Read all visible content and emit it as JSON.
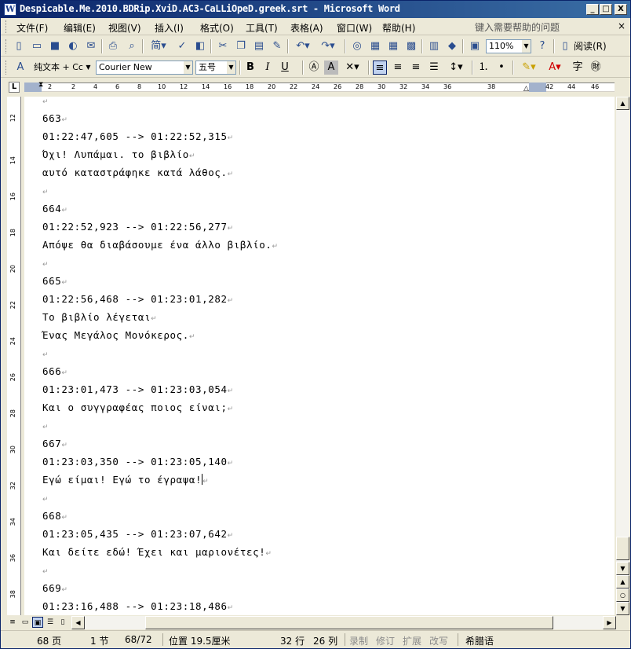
{
  "window": {
    "title": "Despicable.Me.2010.BDRip.XviD.AC3-CaLLiOpeD.greek.srt - Microsoft Word",
    "app_icon": "W",
    "minimize": "_",
    "maximize": "□",
    "close": "X"
  },
  "menu": {
    "items": [
      "文件(F)",
      "编辑(E)",
      "视图(V)",
      "插入(I)",
      "格式(O)",
      "工具(T)",
      "表格(A)",
      "窗口(W)",
      "帮助(H)"
    ],
    "help_placeholder": "键入需要帮助的问题",
    "close_doc": "×"
  },
  "toolbar_standard": {
    "zoom": "110%",
    "read_label": "阅读(R)"
  },
  "toolbar_format": {
    "style": "纯文本 + Cc",
    "font": "Courier New",
    "size": "五号",
    "bold": "B",
    "italic": "I",
    "underline": "U"
  },
  "ruler": {
    "corner": "L",
    "marks": [
      "2",
      "2",
      "4",
      "6",
      "8",
      "10",
      "12",
      "14",
      "16",
      "18",
      "20",
      "22",
      "24",
      "26",
      "28",
      "30",
      "32",
      "34",
      "36",
      "38",
      "42",
      "44",
      "46"
    ]
  },
  "vruler": {
    "marks": [
      "12",
      "14",
      "16",
      "18",
      "20",
      "22",
      "24",
      "26",
      "28",
      "30",
      "32",
      "34",
      "36",
      "38"
    ]
  },
  "document": {
    "lines": [
      "",
      "663",
      "01:22:47,605 --> 01:22:52,315",
      "Όχι! Λυπάμαι. το βιβλίο",
      "αυτό καταστράφηκε κατά λάθος.",
      "",
      "664",
      "01:22:52,923 --> 01:22:56,277",
      "Απόψε θα διαβάσουμε ένα άλλο βιβλίο.",
      "",
      "665",
      "01:22:56,468 --> 01:23:01,282",
      "Το βιβλίο λέγεται",
      "Ένας Μεγάλος Μονόκερος.",
      "",
      "666",
      "01:23:01,473 --> 01:23:03,054",
      "Και ο συγγραφέας ποιος είναι;",
      "",
      "667",
      "01:23:03,350 --> 01:23:05,140",
      "Εγώ είμαι! Εγώ το έγραψα!",
      "",
      "668",
      "01:23:05,435 --> 01:23:07,642",
      "Και δείτε εδώ! Έχει και μαριονέτες!",
      "",
      "669",
      "01:23:16,488 --> 01:23:18,486"
    ],
    "paragraph_mark": "↵"
  },
  "status": {
    "page": "68 页",
    "section": "1 节",
    "page_of": "68/72",
    "position": "位置 19.5厘米",
    "line": "32 行",
    "column": "26 列",
    "rec": "录制",
    "trk": "修订",
    "ext": "扩展",
    "ovr": "改写",
    "language": "希腊语"
  }
}
